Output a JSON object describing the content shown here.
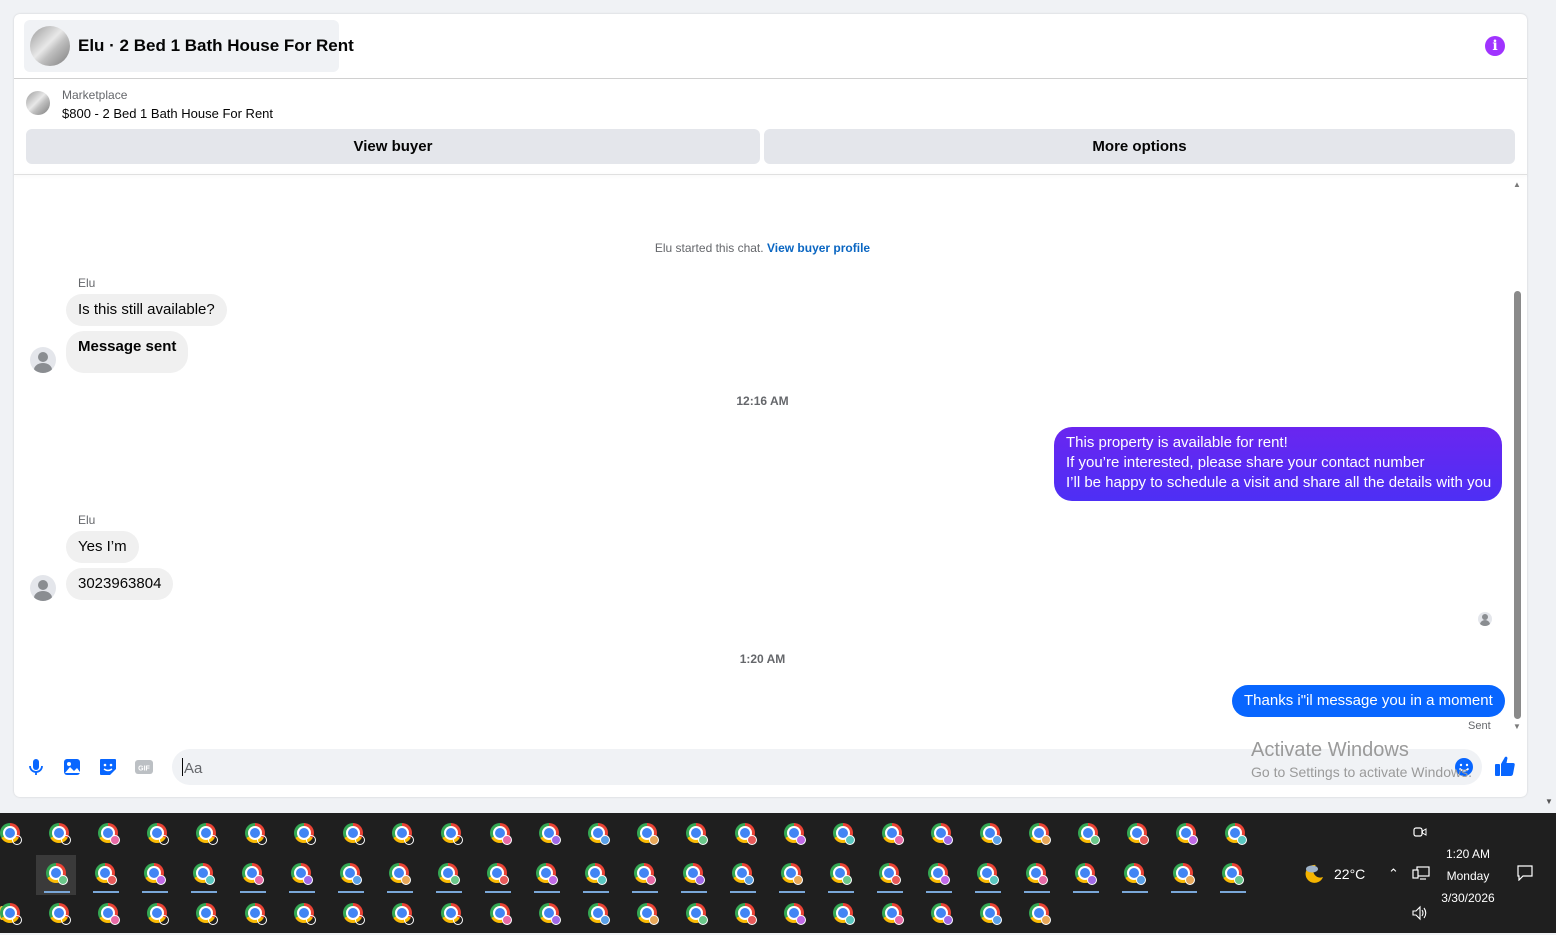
{
  "conversation": {
    "title": "Elu · 2 Bed 1 Bath House For Rent",
    "info_icon": "info-icon"
  },
  "listing": {
    "label": "Marketplace",
    "title": "$800 - 2 Bed 1 Bath House For Rent"
  },
  "actions": {
    "view_buyer": "View buyer",
    "more_options": "More options"
  },
  "chat": {
    "started_text": "Elu started this chat.",
    "started_link": "View buyer profile",
    "messages": [
      {
        "sender": "Elu",
        "text": "Is this still available?"
      },
      {
        "text": "Message sent"
      },
      {
        "time": "12:16 AM"
      },
      {
        "lines": [
          "This property is available for rent!",
          "If you’re interested, please share your contact number",
          "I’ll be happy to schedule a visit and share all the details with you"
        ]
      },
      {
        "sender": "Elu",
        "text": "Yes I’m"
      },
      {
        "text": "3023963804"
      },
      {
        "time": "1:20 AM"
      },
      {
        "text": "Thanks i\"il message you in a moment",
        "status": "Sent"
      }
    ]
  },
  "composer": {
    "placeholder": "Aa",
    "value": ""
  },
  "watermark": {
    "title": "Activate Windows",
    "subtitle": "Go to Settings to activate Windows."
  },
  "taskbar": {
    "temperature": "22°C",
    "time": "1:20 AM",
    "day": "Monday",
    "date": "3/30/2026"
  },
  "colors": {
    "accent_purple": "#a033ff",
    "outgoing_bubble": "#5c2cf4",
    "outgoing_bubble_blue": "#0866ff",
    "link_blue": "#0a66c2",
    "taskbar_bg": "#1f1f1f"
  }
}
